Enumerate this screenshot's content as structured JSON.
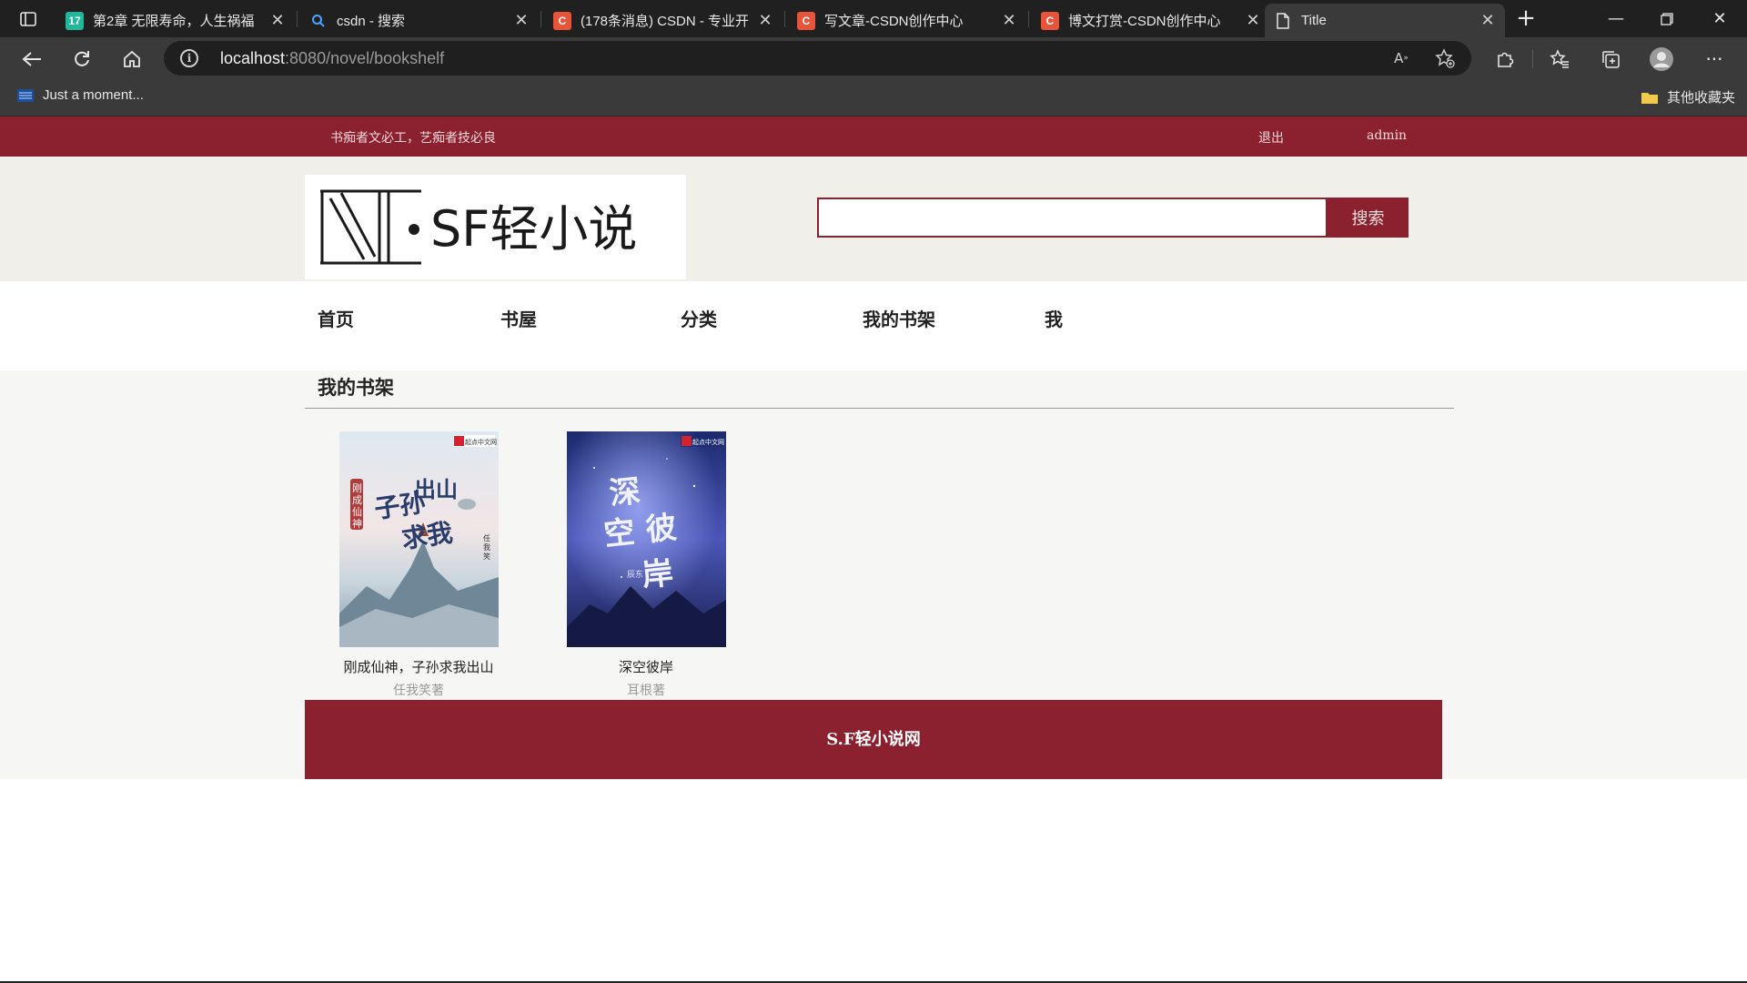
{
  "browser": {
    "tabs": [
      {
        "title": "第2章 无限寿命，人生祸福",
        "favicon_text": "17",
        "favicon_color": "#1fb89a",
        "active": false
      },
      {
        "title": "csdn - 搜索",
        "favicon_text": "",
        "favicon_color": "#202020",
        "active": false
      },
      {
        "title": "(178条消息) CSDN - 专业开",
        "favicon_text": "C",
        "favicon_color": "#e8543a",
        "active": false
      },
      {
        "title": "写文章-CSDN创作中心",
        "favicon_text": "C",
        "favicon_color": "#e8543a",
        "active": false
      },
      {
        "title": "博文打赏-CSDN创作中心",
        "favicon_text": "C",
        "favicon_color": "#e8543a",
        "active": false
      },
      {
        "title": "Title",
        "favicon_text": "",
        "favicon_color": "#3a3a3a",
        "active": true
      }
    ],
    "url_host": "localhost",
    "url_rest": ":8080/novel/bookshelf",
    "bookmarks": [
      {
        "label": "Just a moment..."
      }
    ],
    "other_bookmarks": "其他收藏夹"
  },
  "site": {
    "slogan": "书痴者文必工，艺痴者技必良",
    "logout": "退出",
    "username": "admin",
    "logo_text": "SF轻小说",
    "search": {
      "value": "",
      "button": "搜索"
    },
    "nav": [
      "首页",
      "书屋",
      "分类",
      "我的书架",
      "我"
    ],
    "shelf_title": "我的书架",
    "books": [
      {
        "title": "刚成仙神，子孙求我出山",
        "author": "任我笑著",
        "cover_title": "子孙求我出山",
        "cover_sub": "刚成仙神",
        "cover_author": "任我笑",
        "cover_badge": "起点中文网"
      },
      {
        "title": "深空彼岸",
        "author": "耳根著",
        "cover_title": "深空彼岸",
        "cover_author": "辰东",
        "cover_badge": "起点中文网"
      }
    ],
    "footer": "S.F轻小说网"
  },
  "colors": {
    "brand": "#8b212e",
    "header_bg": "#f1efe9",
    "content_bg": "#f6f6f4"
  }
}
